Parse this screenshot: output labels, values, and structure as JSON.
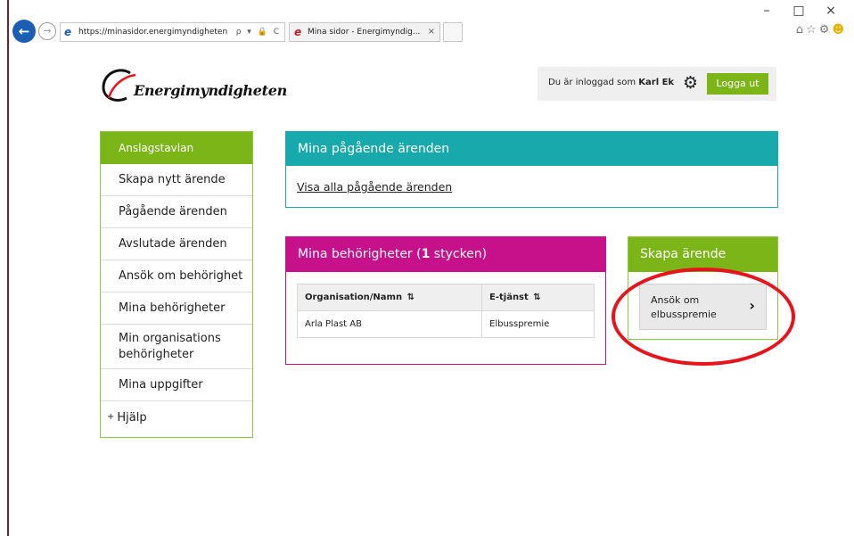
{
  "browser": {
    "back_icon": "back-arrow-icon",
    "forward_icon": "forward-arrow-icon",
    "address": "https://minasidor.energimyndigheten...",
    "address_tools": "ρ ▾ 🔒 C",
    "tab_title": "Mina sidor - Energimyndig...",
    "tab_close": "×",
    "window_controls": {
      "minimize": "–",
      "maximize": "□",
      "close": "×"
    },
    "toolbar_icons": [
      "home-icon",
      "star-icon",
      "gear-icon",
      "smiley-icon"
    ]
  },
  "header": {
    "logo_text": "Energimyndigheten",
    "user_prefix": "Du är inloggad som",
    "user_name": "Karl Ek",
    "logout_label": "Logga ut"
  },
  "sidebar": {
    "items": [
      {
        "label": "Anslagstavlan",
        "active": true
      },
      {
        "label": "Skapa nytt ärende"
      },
      {
        "label": "Pågående ärenden"
      },
      {
        "label": "Avslutade ärenden"
      },
      {
        "label": "Ansök om behörighet"
      },
      {
        "label": "Mina behörigheter"
      },
      {
        "label": "Min organisations behörigheter"
      },
      {
        "label": "Mina uppgifter"
      },
      {
        "label": "Hjälp",
        "prefix": "+"
      }
    ]
  },
  "ongoing": {
    "title": "Mina pågående ärenden",
    "link": "Visa alla pågående ärenden"
  },
  "permissions": {
    "title_prefix": "Mina behörigheter (",
    "count": "1",
    "title_suffix": " stycken)",
    "columns": [
      "Organisation/Namn",
      "E-tjänst"
    ],
    "sort_glyph": "⇅",
    "rows": [
      [
        "Arla Plast AB",
        "Elbusspremie"
      ]
    ]
  },
  "create": {
    "title": "Skapa ärende",
    "button_label": "Ansök om elbusspremie",
    "chevron": "›"
  },
  "colors": {
    "teal": "#18a9ad",
    "magenta": "#c7118a",
    "green": "#7cb518",
    "highlight": "#e8141b"
  }
}
